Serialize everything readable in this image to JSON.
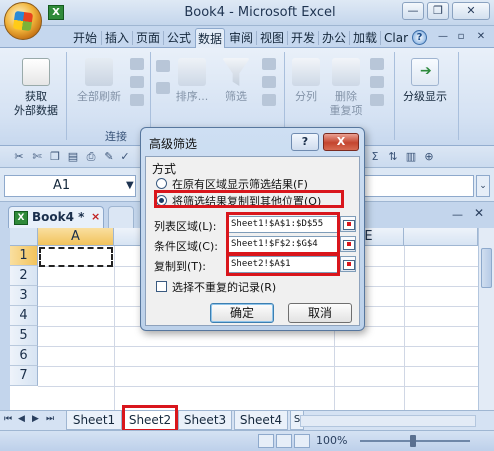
{
  "window": {
    "title": "Book4 - Microsoft Excel"
  },
  "ribbon": {
    "tabs": [
      "开始",
      "插入",
      "页面",
      "公式",
      "数据",
      "审阅",
      "视图",
      "开发",
      "办公",
      "加载",
      "Clar"
    ],
    "selected_tab": "数据",
    "buttons": {
      "get_external_data": [
        "获取",
        "外部数据"
      ],
      "refresh_all": "全部刷新",
      "sort": "排序...",
      "filter": "筛选",
      "text_to_columns": "分列",
      "remove_duplicates": [
        "删除",
        "重复项"
      ],
      "outline": "分级显示"
    },
    "groups": {
      "connections": "连接"
    }
  },
  "formula_bar": {
    "name_box": "A1",
    "name_box_arrow": "▼",
    "expand": "⌄"
  },
  "workbook": {
    "tab_title": "Book4 *",
    "close": "×",
    "minimize": "—",
    "close_window": "✕"
  },
  "grid": {
    "columns": [
      "A",
      "E"
    ],
    "rows": [
      "1",
      "2",
      "3",
      "4",
      "5",
      "6",
      "7"
    ],
    "active_cell": "A1"
  },
  "sheets": [
    "Sheet1",
    "Sheet2",
    "Sheet3",
    "Sheet4",
    "S"
  ],
  "status": {
    "zoom": "100%"
  },
  "dialog": {
    "title": "高级筛选",
    "help": "?",
    "close": "X",
    "mode_label": "方式",
    "options": [
      {
        "label": "在原有区域显示筛选结果(F)",
        "selected": false
      },
      {
        "label": "将筛选结果复制到其他位置(O)",
        "selected": true
      }
    ],
    "list_range_label": "列表区域(L):",
    "list_range_value": "Sheet1!$A$1:$D$55",
    "criteria_range_label": "条件区域(C):",
    "criteria_range_value": "Sheet1!$F$2:$G$4",
    "copy_to_label": "复制到(T):",
    "copy_to_value": "Sheet2!$A$1",
    "unique_label": "选择不重复的记录(R)",
    "unique_checked": false,
    "ok": "确定",
    "cancel": "取消"
  },
  "colors": {
    "highlight": "#d9161c",
    "ribbon": "#d5e2f3",
    "dialog_body": "#f0f0f0"
  }
}
